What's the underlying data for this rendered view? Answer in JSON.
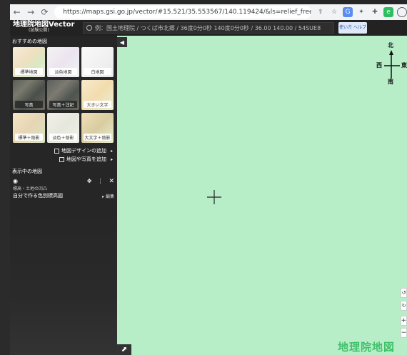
{
  "browser": {
    "url": "https://maps.gsi.go.jp/vector/#15.521/35.553567/140.119424/&ls=relief_free%2C0...",
    "nav": {
      "back_icon": "arrow-left-icon",
      "forward_icon": "arrow-right-icon",
      "reload_icon": "reload-icon"
    }
  },
  "app": {
    "title": "地理院地図Vector",
    "subtitle": "(試験公開)",
    "search_placeholder": "例：国土地理院 / つくば市北郷 / 36度0分0秒 140度0分0秒 / 36.00 140.00 / 54SUE8",
    "header_button": "使い方 ヘルプ"
  },
  "sidebar": {
    "recommended_title": "おすすめの地図",
    "tiles": [
      {
        "label": "標準地図"
      },
      {
        "label": "淡色地図"
      },
      {
        "label": "白地図"
      },
      {
        "label": "写真"
      },
      {
        "label": "写真＋注記"
      },
      {
        "label": "大きい文字"
      },
      {
        "label": "標準＋陰影"
      },
      {
        "label": "淡色＋陰影"
      },
      {
        "label": "大文字＋陰影"
      }
    ],
    "add_design_label": "地図デザインの追加",
    "add_photo_label": "地図や写真を追加",
    "shown_title": "表示中の地図",
    "layer_category": "標高・土地の凹凸",
    "layer_name": "自分で作る色別標高図",
    "layer_edit": "編集"
  },
  "map": {
    "compass": {
      "north": "北",
      "south": "南",
      "east": "東",
      "west": "西"
    },
    "zoom_in": "+",
    "zoom_out": "−",
    "watermark": "地理院地図",
    "background_color": "#b7eec8"
  }
}
